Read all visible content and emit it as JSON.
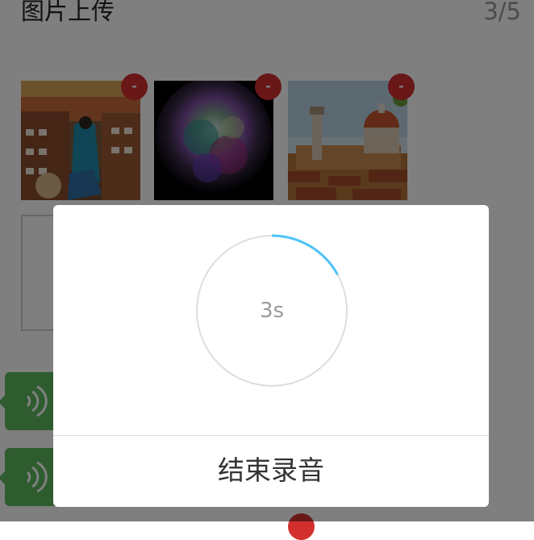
{
  "header": {
    "title": "图片上传",
    "count": "3/5"
  },
  "images": [
    {
      "name": "travel-photo",
      "remove_label": "-"
    },
    {
      "name": "color-explosion-photo",
      "remove_label": "-"
    },
    {
      "name": "florence-photo",
      "remove_label": "-"
    }
  ],
  "voice_messages": [
    {
      "icon": "voice-wave-icon"
    },
    {
      "icon": "voice-wave-icon"
    }
  ],
  "recording_dialog": {
    "elapsed": "3s",
    "progress": 0.17,
    "stop_label": "结束录音"
  },
  "colors": {
    "accent": "#4fc3f7",
    "remove": "#d32f2f",
    "voice": "#5cb85c"
  }
}
